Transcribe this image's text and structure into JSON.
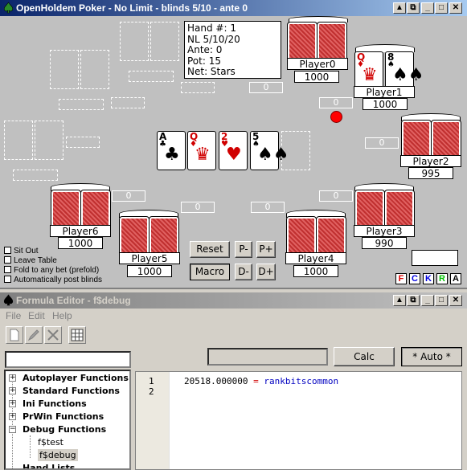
{
  "main_window": {
    "title": "OpenHoldem Poker - No Limit - blinds 5/10 - ante 0",
    "buttons": [
      "_",
      "□",
      "✕"
    ]
  },
  "hand_info": {
    "line1": "Hand #: 1",
    "line2": "NL 5/10/20",
    "line3": "Ante: 0",
    "line4": "Pot: 15",
    "line5": "Net: Stars"
  },
  "board": [
    {
      "rank": "A",
      "suit": "♣",
      "color": "black"
    },
    {
      "rank": "Q",
      "suit": "♦",
      "color": "red"
    },
    {
      "rank": "2",
      "suit": "♥",
      "color": "red"
    },
    {
      "rank": "5",
      "suit": "♠",
      "color": "black"
    }
  ],
  "players": {
    "p0": {
      "name": "Player0",
      "balance": "1000",
      "bet": "0"
    },
    "p1": {
      "name": "Player1",
      "balance": "1000",
      "bet": "0",
      "cards": [
        {
          "rank": "Q",
          "suit": "♦",
          "color": "red"
        },
        {
          "rank": "8",
          "suit": "♠",
          "color": "black"
        }
      ]
    },
    "p2": {
      "name": "Player2",
      "balance": "995",
      "bet": "0"
    },
    "p3": {
      "name": "Player3",
      "balance": "990",
      "bet": "0"
    },
    "p4": {
      "name": "Player4",
      "balance": "1000",
      "bet": "0"
    },
    "p5": {
      "name": "Player5",
      "balance": "1000",
      "bet": "0"
    },
    "p6": {
      "name": "Player6",
      "balance": "1000",
      "bet": "0"
    }
  },
  "center_bet": "0",
  "controls": {
    "reset": "Reset",
    "macro": "Macro",
    "p_minus": "P-",
    "p_plus": "P+",
    "d_minus": "D-",
    "d_plus": "D+"
  },
  "checkboxes": [
    "Sit Out",
    "Leave Table",
    "Fold to any bet (prefold)",
    "Automatically post blinds"
  ],
  "flags": [
    {
      "label": "F",
      "color": "#e00000"
    },
    {
      "label": "C",
      "color": "#0000e0"
    },
    {
      "label": "K",
      "color": "#0000e0"
    },
    {
      "label": "R",
      "color": "#00c000"
    },
    {
      "label": "A",
      "color": "#000000"
    }
  ],
  "formula_window": {
    "title": "Formula Editor - f$debug",
    "menu": [
      "File",
      "Edit",
      "Help"
    ],
    "calc_label": "Calc",
    "auto_label": "* Auto *",
    "tree": [
      {
        "label": "Autoplayer Functions",
        "expander": "+"
      },
      {
        "label": "Standard Functions",
        "expander": "+"
      },
      {
        "label": "Ini Functions",
        "expander": "+"
      },
      {
        "label": "PrWin Functions",
        "expander": "+"
      },
      {
        "label": "Debug Functions",
        "expander": "−"
      },
      {
        "label": "f$test",
        "expander": ""
      },
      {
        "label": "f$debug",
        "expander": ""
      },
      {
        "label": "Hand Lists",
        "expander": ""
      }
    ],
    "line_numbers": [
      "1",
      "2"
    ],
    "code_value": "20518.000000",
    "code_eq": "=",
    "code_symbol": "rankbitscommon"
  }
}
